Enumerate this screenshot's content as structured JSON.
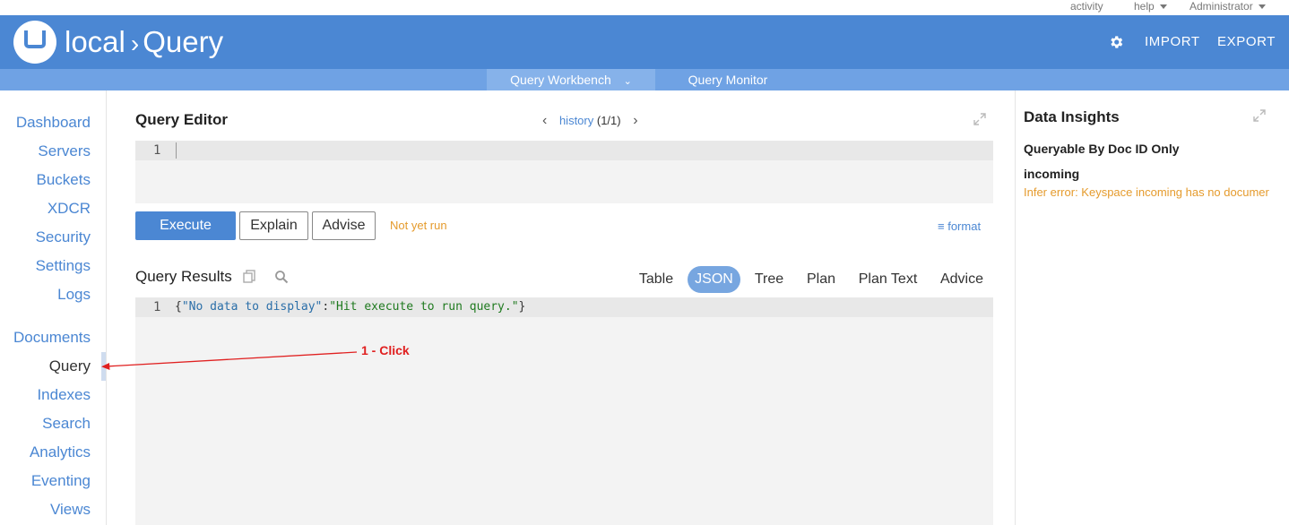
{
  "topbar": {
    "activity": "activity",
    "help": "help",
    "user": "Administrator"
  },
  "header": {
    "cluster": "local",
    "page": "Query",
    "import": "IMPORT",
    "export": "EXPORT"
  },
  "subnav": {
    "tabs": [
      {
        "label": "Query Workbench"
      },
      {
        "label": "Query Monitor"
      }
    ]
  },
  "sidebar": {
    "items": [
      {
        "label": "Dashboard"
      },
      {
        "label": "Servers"
      },
      {
        "label": "Buckets"
      },
      {
        "label": "XDCR"
      },
      {
        "label": "Security"
      },
      {
        "label": "Settings"
      },
      {
        "label": "Logs"
      },
      {
        "label": "Documents"
      },
      {
        "label": "Query"
      },
      {
        "label": "Indexes"
      },
      {
        "label": "Search"
      },
      {
        "label": "Analytics"
      },
      {
        "label": "Eventing"
      },
      {
        "label": "Views"
      }
    ]
  },
  "editor": {
    "title": "Query Editor",
    "history_label": "history",
    "history_count": "(1/1)",
    "line_number": "1",
    "execute": "Execute",
    "explain": "Explain",
    "advise": "Advise",
    "status": "Not yet run",
    "format": "format"
  },
  "results": {
    "title": "Query Results",
    "tabs": [
      {
        "label": "Table"
      },
      {
        "label": "JSON"
      },
      {
        "label": "Tree"
      },
      {
        "label": "Plan"
      },
      {
        "label": "Plan Text"
      },
      {
        "label": "Advice"
      }
    ],
    "active_tab": "JSON",
    "line_number": "1",
    "json_open": "{",
    "json_key": "\"No data to display\"",
    "json_colon": ":",
    "json_value": "\"Hit execute to run query.\"",
    "json_close": "}"
  },
  "insights": {
    "title": "Data Insights",
    "subtitle": "Queryable By Doc ID Only",
    "bucket": "incoming",
    "error": "Infer error: Keyspace incoming has no documer"
  },
  "annotation": {
    "label": "1 - Click",
    "color": "#e02020"
  },
  "colors": {
    "brand": "#4b87d3",
    "warning": "#e59b2d"
  }
}
